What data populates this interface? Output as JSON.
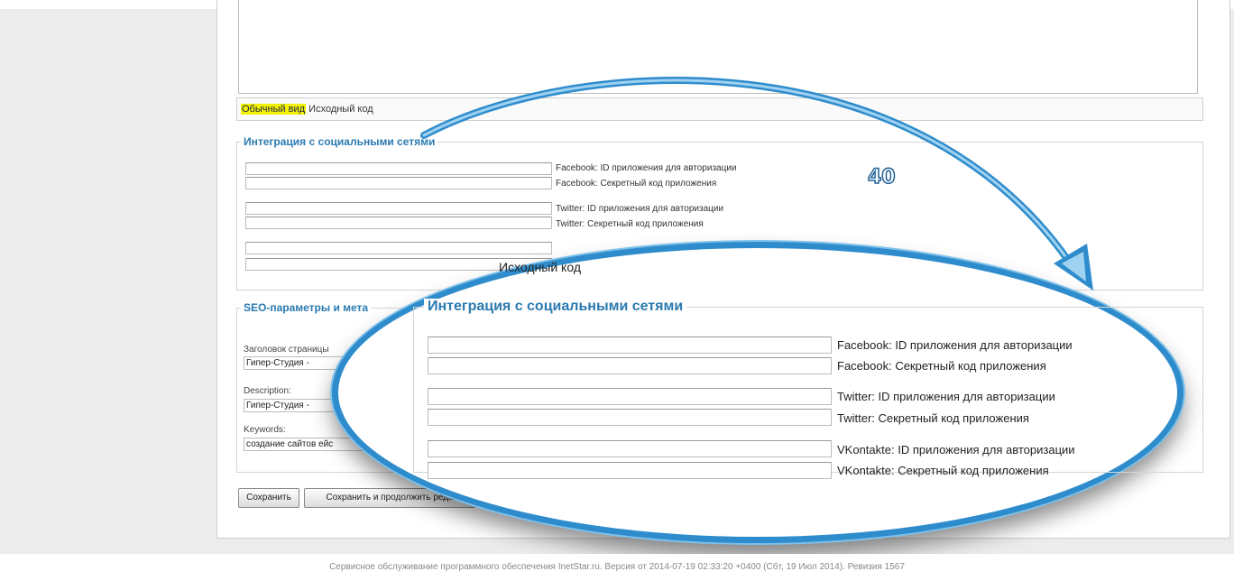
{
  "editor": {
    "tab_visual": "Обычный вид",
    "tab_source": "Исходный код"
  },
  "social": {
    "legend": "Интеграция с социальными сетями",
    "fields": [
      {
        "label": "Facebook: ID приложения для авторизации",
        "value": ""
      },
      {
        "label": "Facebook: Секретный код приложения",
        "value": ""
      },
      {
        "label": "Twitter: ID приложения для авторизации",
        "value": ""
      },
      {
        "label": "Twitter: Секретный код приложения",
        "value": ""
      },
      {
        "label": "VKontakte: ID приложения для авторизации",
        "value": ""
      },
      {
        "label": "VKontakte: Секретный код приложения",
        "value": ""
      }
    ]
  },
  "seo": {
    "legend": "SEO-параметры и мета",
    "title_label": "Заголовок страницы",
    "title_value": "Гипер-Студия -",
    "description_label": "Description:",
    "description_value": "Гипер-Студия -",
    "keywords_label": "Keywords:",
    "keywords_value": "создание сайтов ейс"
  },
  "buttons": {
    "save": "Сохранить",
    "save_continue": "Сохранить и продолжить реда"
  },
  "annotation": {
    "step_number": "40",
    "arrow_color": "#2f8ccc",
    "loupe_color": "#2f8ccc"
  },
  "footer": {
    "text": "Сервисное обслуживание программного обеспечения InetStar.ru. Версия от 2014-07-19 02:33:20 +0400 (Сбт, 19 Июл 2014). Ревизия 1567"
  },
  "colors": {
    "legend": "#2a7ab0",
    "active_tab_highlight": "#f2f200"
  }
}
